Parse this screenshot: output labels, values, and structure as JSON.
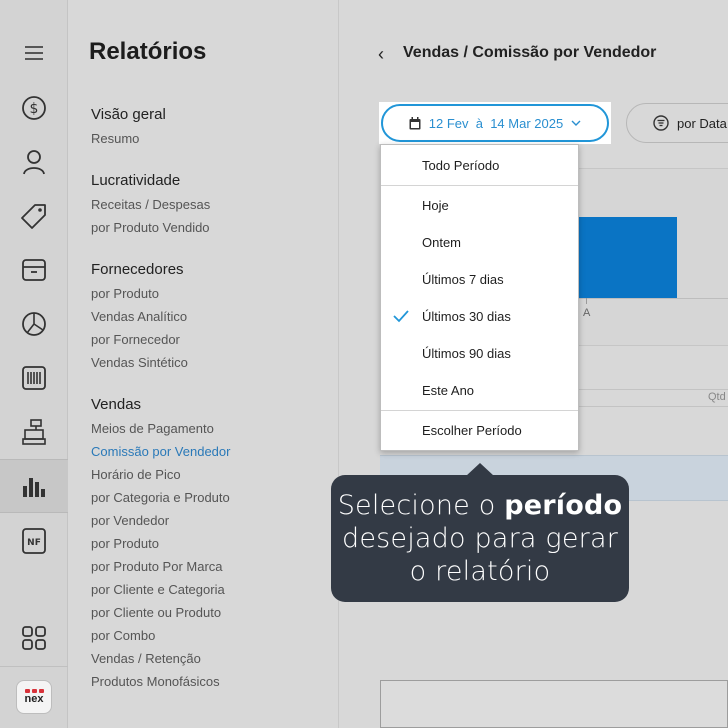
{
  "rail": {
    "icons": [
      "menu-icon",
      "dollar-icon",
      "user-icon",
      "tag-icon",
      "box-icon",
      "pie-icon",
      "barcode-icon",
      "cash-register-icon",
      "bar-chart-icon",
      "nf-icon",
      "apps-icon"
    ],
    "nf_label": "NF",
    "logo_text": "nex"
  },
  "menu": {
    "title": "Relatórios",
    "sections": [
      {
        "label": "Visão geral",
        "items": [
          "Resumo"
        ]
      },
      {
        "label": "Lucratividade",
        "items": [
          "Receitas / Despesas",
          "por Produto Vendido"
        ]
      },
      {
        "label": "Fornecedores",
        "items": [
          "por Produto",
          "Vendas Analítico",
          "por Fornecedor",
          "Vendas Sintético"
        ]
      },
      {
        "label": "Vendas",
        "items": [
          "Meios de Pagamento",
          "Comissão por Vendedor",
          "Horário de Pico",
          "por Categoria e Produto",
          "por Vendedor",
          "por Produto",
          "por Produto Por Marca",
          "por Cliente e Categoria",
          "por Cliente ou Produto",
          "por Combo",
          "Vendas / Retenção",
          "Produtos Monofásicos"
        ]
      }
    ],
    "active_item": "Comissão por Vendedor"
  },
  "header": {
    "back_glyph": "‹",
    "title": "Vendas / Comissão por Vendedor"
  },
  "filters": {
    "date_range": "12 Fev  à  14 Mar 2025",
    "group_by": "por Data"
  },
  "chart_preview": {
    "tick_label": "A",
    "qtd_header": "Qtd"
  },
  "dropdown": {
    "options": [
      "Todo Período",
      "Hoje",
      "Ontem",
      "Últimos 7 dias",
      "Últimos 30 dias",
      "Últimos 90 dias",
      "Este Ano",
      "Escolher Período"
    ],
    "selected": "Últimos 30 dias"
  },
  "tooltip": {
    "line1_pre": "Selecione o ",
    "line1_bold": "período",
    "line2": "desejado para gerar",
    "line3": "o relatório"
  },
  "colors": {
    "accent": "#2196d8",
    "chart_bar": "#0a74c4",
    "tooltip_bg": "#333a45"
  }
}
